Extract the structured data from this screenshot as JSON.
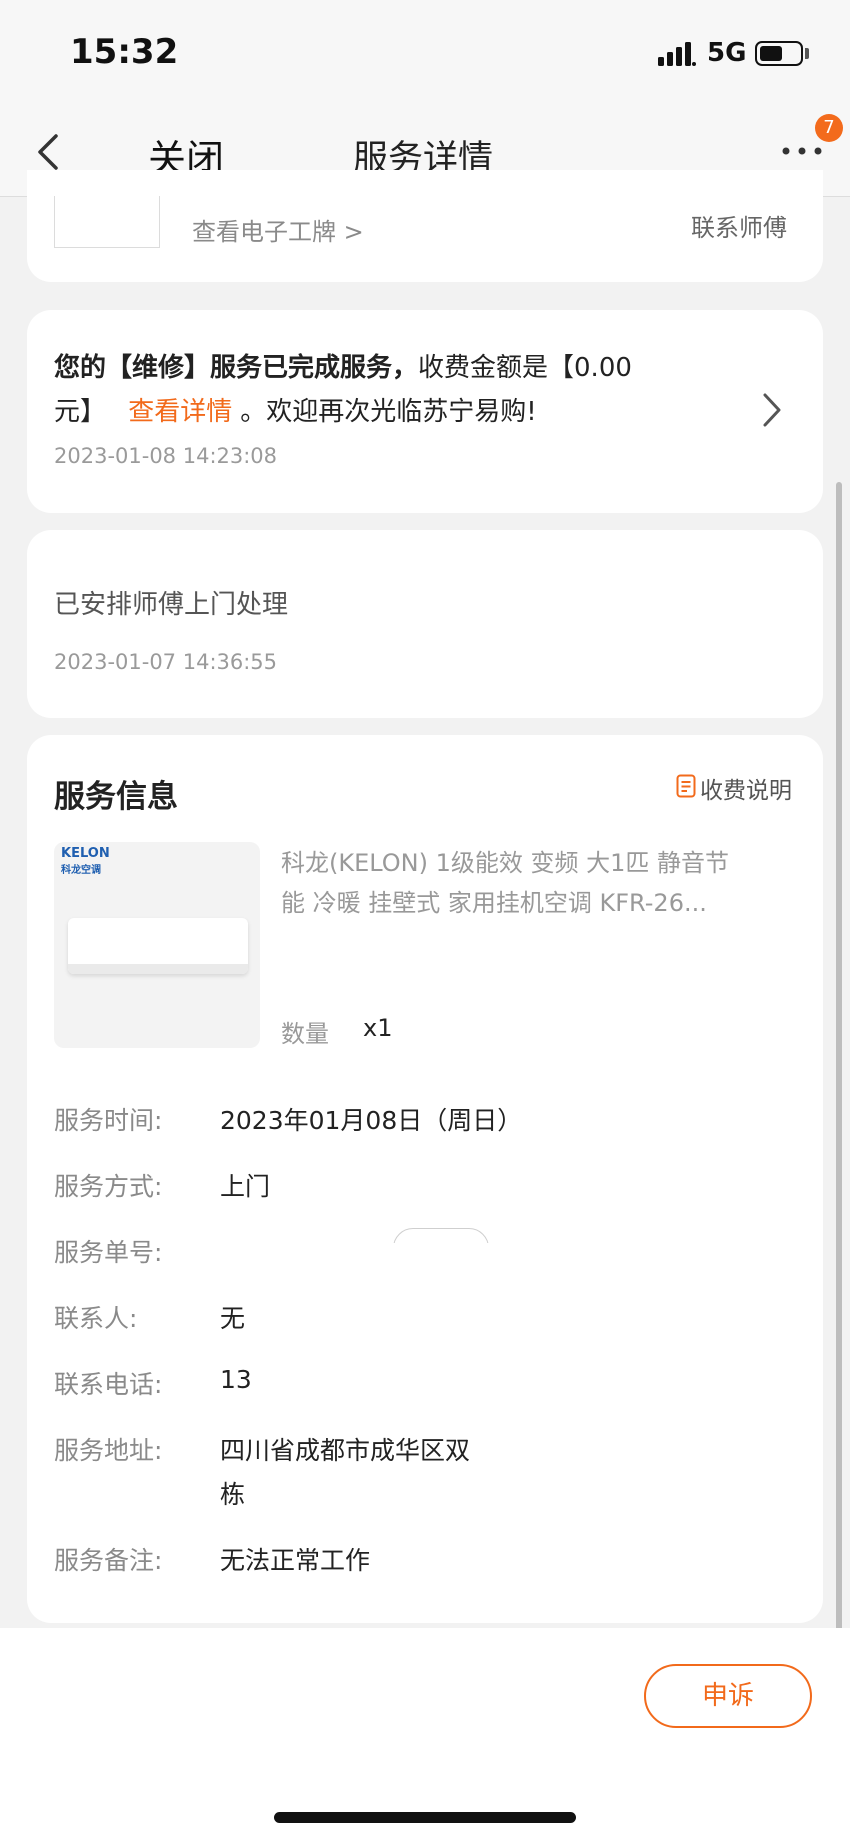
{
  "status_bar": {
    "time": "15:32",
    "network": "5G"
  },
  "nav": {
    "close_label": "关闭",
    "title": "服务详情",
    "badge_count": "7"
  },
  "technician_card": {
    "badge_link": "查看电子工牌 >",
    "contact_link": "联系师傅"
  },
  "timeline": [
    {
      "msg_part1": "您的【维修】服务已完成服务，",
      "msg_part2": "收费金额是【0.00",
      "msg_part3": "元】",
      "detail_link": "查看详情",
      "msg_part4": "。欢迎再次光临苏宁易购!",
      "timestamp": "2023-01-08 14:23:08"
    },
    {
      "message": "已安排师傅上门处理",
      "timestamp": "2023-01-07 14:36:55"
    }
  ],
  "service_info": {
    "title": "服务信息",
    "fee_link": "收费说明",
    "product": {
      "brand_logo": "KELON",
      "brand_logo_cn": "科龙空调",
      "name_line1": "科龙(KELON) 1级能效 变频 大1匹 静音节",
      "name_line2": "能 冷暖 挂壁式 家用挂机空调 KFR-26...",
      "qty_label": "数量",
      "qty_value": "x1"
    },
    "rows": [
      {
        "label": "服务时间:",
        "value": "2023年01月08日（周日）"
      },
      {
        "label": "服务方式:",
        "value": "上门"
      },
      {
        "label": "服务单号:",
        "value": ""
      },
      {
        "label": "联系人:",
        "value": "无"
      },
      {
        "label": "联系电话:",
        "value": "13"
      },
      {
        "label": "服务地址:",
        "value": "四川省成都市成华区双",
        "value_line2": "栋"
      },
      {
        "label": "服务备注:",
        "value": "无法正常工作"
      }
    ]
  },
  "bottom": {
    "appeal_label": "申诉"
  },
  "colors": {
    "accent": "#f26a1b",
    "badge": "#f36b1c",
    "background": "#f2f2f2"
  },
  "icons": [
    "back-icon",
    "more-icon",
    "chevron-right-icon",
    "document-icon",
    "signal-icon",
    "battery-icon"
  ]
}
